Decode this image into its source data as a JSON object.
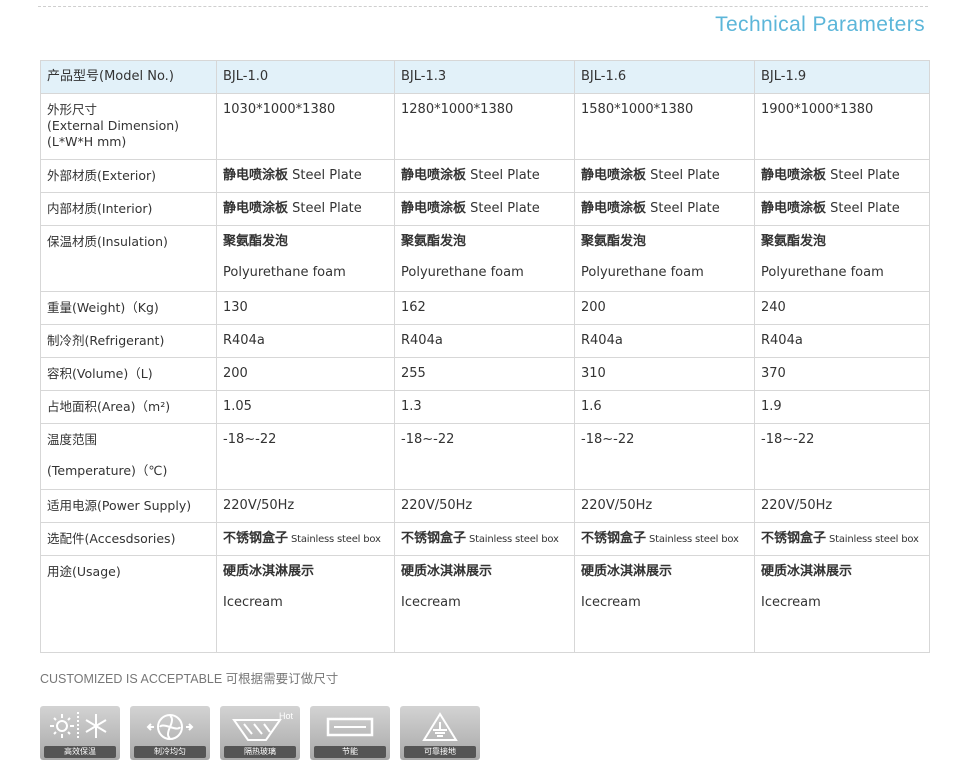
{
  "section_title": "Technical Parameters",
  "table": {
    "model_label": "产品型号(Model No.)",
    "models": [
      "BJL-1.0",
      "BJL-1.3",
      "BJL-1.6",
      "BJL-1.9"
    ],
    "rows": [
      {
        "label": [
          "外形尺寸",
          "(External Dimension)",
          "(L*W*H mm)"
        ],
        "values": [
          [
            "1030*1000*1380"
          ],
          [
            "1280*1000*1380"
          ],
          [
            "1580*1000*1380"
          ],
          [
            "1900*1000*1380"
          ]
        ]
      },
      {
        "label": [
          "外部材质(Exterior)"
        ],
        "values": [
          [
            "静电喷涂板",
            " Steel Plate"
          ],
          [
            "静电喷涂板",
            " Steel Plate"
          ],
          [
            "静电喷涂板",
            " Steel Plate"
          ],
          [
            "静电喷涂板",
            " Steel Plate"
          ]
        ]
      },
      {
        "label": [
          "内部材质(Interior)"
        ],
        "values": [
          [
            "静电喷涂板",
            " Steel Plate"
          ],
          [
            "静电喷涂板",
            " Steel Plate"
          ],
          [
            "静电喷涂板",
            " Steel Plate"
          ],
          [
            "静电喷涂板",
            " Steel Plate"
          ]
        ]
      },
      {
        "label": [
          "保温材质(Insulation)"
        ],
        "values": [
          [
            "聚氨酯发泡",
            "Polyurethane foam"
          ],
          [
            "聚氨酯发泡",
            "Polyurethane foam"
          ],
          [
            "聚氨酯发泡",
            "Polyurethane foam"
          ],
          [
            "聚氨酯发泡",
            "Polyurethane foam"
          ]
        ]
      },
      {
        "label": [
          "重量(Weight)（Kg)"
        ],
        "values": [
          [
            "130"
          ],
          [
            "162"
          ],
          [
            "200"
          ],
          [
            "240"
          ]
        ]
      },
      {
        "label": [
          "制冷剂(Refrigerant)"
        ],
        "values": [
          [
            "R404a"
          ],
          [
            "R404a"
          ],
          [
            "R404a"
          ],
          [
            "R404a"
          ]
        ]
      },
      {
        "label": [
          "容积(Volume)（L)"
        ],
        "values": [
          [
            "200"
          ],
          [
            "255"
          ],
          [
            "310"
          ],
          [
            "370"
          ]
        ]
      },
      {
        "label": [
          "占地面积(Area)（m²)"
        ],
        "values": [
          [
            "1.05"
          ],
          [
            "1.3"
          ],
          [
            "1.6"
          ],
          [
            "1.9"
          ]
        ]
      },
      {
        "label": [
          "温度范围",
          "(Temperature)（℃)"
        ],
        "values": [
          [
            "-18~-22"
          ],
          [
            "-18~-22"
          ],
          [
            "-18~-22"
          ],
          [
            "-18~-22"
          ]
        ]
      },
      {
        "label": [
          "适用电源(Power Supply)"
        ],
        "values": [
          [
            "220V/50Hz"
          ],
          [
            "220V/50Hz"
          ],
          [
            "220V/50Hz"
          ],
          [
            "220V/50Hz"
          ]
        ]
      },
      {
        "label": [
          "选配件(Accesdsories)"
        ],
        "values": [
          [
            "不锈钢盒子",
            " Stainless steel box"
          ],
          [
            "不锈钢盒子",
            " Stainless steel box"
          ],
          [
            "不锈钢盒子",
            " Stainless steel box"
          ],
          [
            "不锈钢盒子",
            " Stainless steel box"
          ]
        ]
      },
      {
        "label": [
          "用途(Usage)"
        ],
        "values": [
          [
            "硬质冰淇淋展示",
            "Icecream"
          ],
          [
            "硬质冰淇淋展示",
            "Icecream"
          ],
          [
            "硬质冰淇淋展示",
            "Icecream"
          ],
          [
            "硬质冰淇淋展示",
            "Icecream"
          ]
        ]
      }
    ]
  },
  "note": "CUSTOMIZED IS ACCEPTABLE  可根据需要订做尺寸",
  "feature_icons": [
    {
      "icon": "snowflake-sun-icon",
      "caption": "高效保温"
    },
    {
      "icon": "fan-icon",
      "caption": "制冷均匀"
    },
    {
      "icon": "glass-icon",
      "caption": "隔热玻璃",
      "badge": "Hot"
    },
    {
      "icon": "battery-icon",
      "caption": "节能"
    },
    {
      "icon": "ground-warning-icon",
      "caption": "可靠接地"
    }
  ],
  "colors": {
    "title": "#5cb6d9",
    "header_row_bg": "#e2f1f9",
    "border": "#d7d7d7",
    "icon_caption_bg": "#555555"
  }
}
